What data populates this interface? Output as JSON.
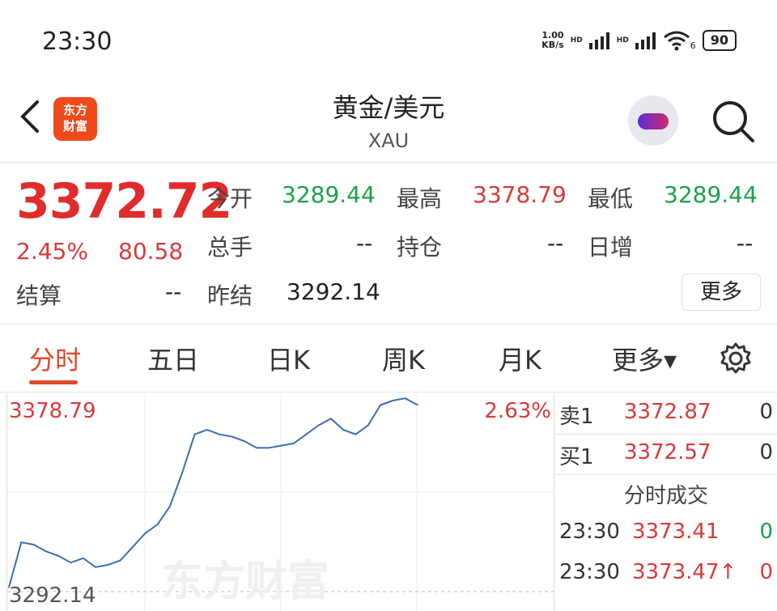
{
  "status": {
    "time": "23:30",
    "net_speed_value": "1.00",
    "net_speed_unit": "KB/s",
    "hd1": "HD",
    "hd2": "HD",
    "wifi_sub": "6",
    "battery": "90"
  },
  "header": {
    "title": "黄金/美元",
    "subtitle": "XAU",
    "logo_line1": "东方",
    "logo_line2": "财富"
  },
  "quote": {
    "price": "3372.72",
    "change_pct": "2.45%",
    "change_amt": "80.58",
    "open_label": "今开",
    "open": "3289.44",
    "high_label": "最高",
    "high": "3378.79",
    "low_label": "最低",
    "low": "3289.44",
    "volume_label": "总手",
    "volume": "--",
    "position_label": "持仓",
    "position": "--",
    "daily_inc_label": "日增",
    "daily_inc": "--",
    "settle_label": "结算",
    "settle": "--",
    "prev_settle_label": "昨结",
    "prev_settle": "3292.14",
    "more_label": "更多"
  },
  "tabs": [
    {
      "label": "分时",
      "active": true
    },
    {
      "label": "五日",
      "active": false
    },
    {
      "label": "日K",
      "active": false
    },
    {
      "label": "周K",
      "active": false
    },
    {
      "label": "月K",
      "active": false
    },
    {
      "label": "更多▾",
      "active": false
    }
  ],
  "chart_data": {
    "type": "line",
    "y_top_label": "3378.79",
    "y_bottom_label": "3292.14",
    "pct_label": "2.63%",
    "ylim": [
      3292.14,
      3378.79
    ],
    "watermark": "东方财富",
    "x": [
      0,
      3,
      6,
      9,
      12,
      15,
      18,
      21,
      24,
      27,
      30,
      33,
      36,
      39,
      42,
      45,
      48,
      51,
      54,
      57,
      60,
      63,
      66,
      69,
      72,
      75,
      78,
      81,
      84,
      87,
      90,
      93,
      96,
      99
    ],
    "values": [
      3294,
      3314,
      3313,
      3310,
      3308,
      3305,
      3307,
      3303,
      3304,
      3306,
      3312,
      3318,
      3322,
      3330,
      3345,
      3362,
      3364,
      3362,
      3361,
      3359,
      3356,
      3356,
      3357,
      3358,
      3362,
      3366,
      3369,
      3364,
      3362,
      3366,
      3375,
      3377,
      3378,
      3375
    ],
    "line_color": "#3b6fb0"
  },
  "orderbook": {
    "sell_label": "卖1",
    "sell_price": "3372.87",
    "sell_qty": "0",
    "buy_label": "买1",
    "buy_price": "3372.57",
    "buy_qty": "0",
    "trades_title": "分时成交",
    "trades": [
      {
        "time": "23:30",
        "price": "3373.41",
        "qty": "0"
      },
      {
        "time": "23:30",
        "price": "3373.47↑",
        "qty": "0"
      }
    ]
  },
  "colors": {
    "up": "#d93a3a",
    "down": "#1aa34a",
    "accent": "#e0482a"
  }
}
